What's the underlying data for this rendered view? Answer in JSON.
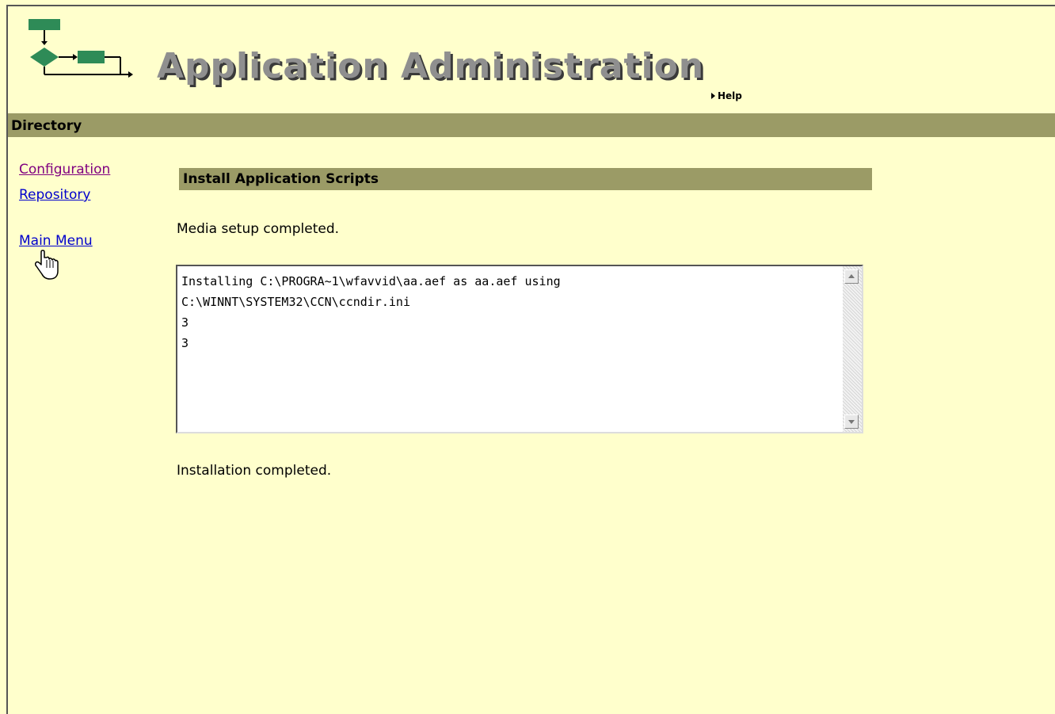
{
  "header": {
    "title": "Application Administration",
    "help_label": "Help"
  },
  "directory_bar": {
    "title": "Directory"
  },
  "sidebar": {
    "links": [
      {
        "label": "Configuration",
        "visited": true
      },
      {
        "label": "Repository",
        "visited": false
      },
      {
        "label": "Main Menu",
        "visited": false
      }
    ]
  },
  "main": {
    "section_title": "Install Application Scripts",
    "media_status": "Media setup completed.",
    "log_text": "Installing C:\\PROGRA~1\\wfavvid\\aa.aef as aa.aef using\nC:\\WINNT\\SYSTEM32\\CCN\\ccndir.ini\n3\n3",
    "install_status": "Installation completed."
  },
  "colors": {
    "background": "#ffffcc",
    "bar": "#9b9b66",
    "link": "#0000cc",
    "visited_link": "#800080",
    "logo_green": "#2e8b57"
  },
  "icons": {
    "logo": "workflow-logo-icon",
    "help": "triangle-right-icon",
    "cursor": "hand-pointer-icon",
    "scroll_up": "arrow-up-icon",
    "scroll_down": "arrow-down-icon"
  }
}
